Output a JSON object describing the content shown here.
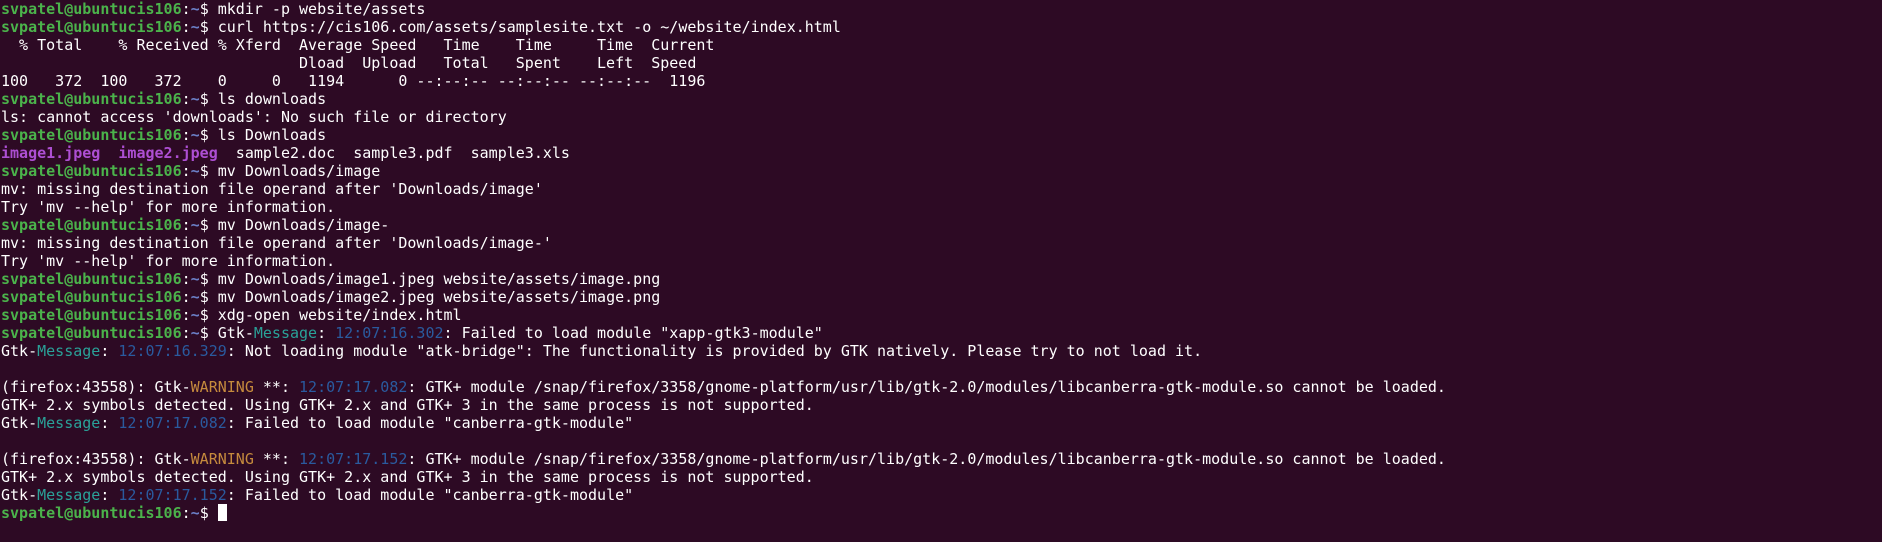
{
  "prompt": {
    "user": "svpatel@ubuntucis106",
    "colon": ":",
    "path": "~",
    "dollar": "$ "
  },
  "commands": {
    "c1": "mkdir -p website/assets",
    "c2": "curl https://cis106.com/assets/samplesite.txt -o ~/website/index.html",
    "c3": "ls downloads",
    "c4": "ls Downloads",
    "c5": "mv Downloads/image",
    "c6": "mv Downloads/image-",
    "c7": "mv Downloads/image1.jpeg website/assets/image.png",
    "c8": "mv Downloads/image2.jpeg website/assets/image.png",
    "c9": "xdg-open website/index.html",
    "c10": "Gtk-",
    "c10_msg_word": "Message",
    "c10_sep": ": ",
    "c10_ts": "12:07:16.302",
    "c10_rest": ": Failed to load module \"xapp-gtk3-module\""
  },
  "curl_output": {
    "h1": "  % Total    % Received % Xferd  Average Speed   Time    Time     Time  Current",
    "h2": "                                 Dload  Upload   Total   Spent    Left  Speed",
    "row": "100   372  100   372    0     0   1194      0 --:--:-- --:--:-- --:--:--  1196"
  },
  "ls_error": "ls: cannot access 'downloads': No such file or directory",
  "ls_files": {
    "image1": "image1.jpeg",
    "image2": "image2.jpeg",
    "rest": "  sample2.doc  sample3.pdf  sample3.xls"
  },
  "mv_errors": {
    "e1": "mv: missing destination file operand after 'Downloads/image'",
    "e2": "Try 'mv --help' for more information.",
    "e3": "mv: missing destination file operand after 'Downloads/image-'",
    "e4": "Try 'mv --help' for more information."
  },
  "gtk": {
    "gtk_prefix": "Gtk-",
    "message_word": "Message",
    "warning_word": "WARNING",
    "m1_ts": "12:07:16.329",
    "m1_rest": ": Not loading module \"atk-bridge\": The functionality is provided by GTK natively. Please try to not load it.",
    "w_prefix": "(firefox:43558): Gtk-",
    "w_stars": " **: ",
    "w1_ts": "12:07:17.082",
    "w_rest": ": GTK+ module /snap/firefox/3358/gnome-platform/usr/lib/gtk-2.0/modules/libcanberra-gtk-module.so cannot be loaded.",
    "w_symbols": "GTK+ 2.x symbols detected. Using GTK+ 2.x and GTK+ 3 in the same process is not supported.",
    "m2_ts": "12:07:17.082",
    "canberra_rest": ": Failed to load module \"canberra-gtk-module\"",
    "w2_ts": "12:07:17.152",
    "m3_ts": "12:07:17.152",
    "sep": ": "
  },
  "colors": {
    "background": "#2d0a24",
    "prompt_user": "#4bb34b",
    "prompt_path": "#6b7fc7",
    "image_files": "#ad4fd3",
    "gtk_message": "#2aa198",
    "gtk_warning": "#c58a3d",
    "timestamp": "#2a5a9e"
  }
}
